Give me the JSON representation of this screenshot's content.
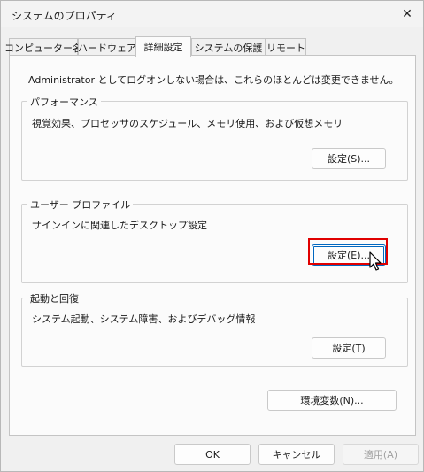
{
  "window": {
    "title": "システムのプロパティ",
    "close_glyph": "✕"
  },
  "tabs": [
    {
      "label": "コンピューター名"
    },
    {
      "label": "ハードウェア"
    },
    {
      "label": "詳細設定"
    },
    {
      "label": "システムの保護"
    },
    {
      "label": "リモート"
    }
  ],
  "active_tab": "詳細設定",
  "panel": {
    "note": "Administrator としてログオンしない場合は、これらのほとんどは変更できません。",
    "performance": {
      "label": "パフォーマンス",
      "description": "視覚効果、プロセッサのスケジュール、メモリ使用、および仮想メモリ",
      "button": "設定(S)..."
    },
    "user_profile": {
      "label": "ユーザー プロファイル",
      "description": "サインインに関連したデスクトップ設定",
      "button": "設定(E)..."
    },
    "startup": {
      "label": "起動と回復",
      "description": "システム起動、システム障害、およびデバッグ情報",
      "button": "設定(T)"
    },
    "env_button": "環境変数(N)..."
  },
  "footer": {
    "ok": "OK",
    "cancel": "キャンセル",
    "apply": "適用(A)"
  },
  "colors": {
    "highlight": "#e00000",
    "focus": "#0067c0"
  },
  "icons": {
    "close": "close-icon",
    "cursor": "mouse-pointer-icon"
  }
}
